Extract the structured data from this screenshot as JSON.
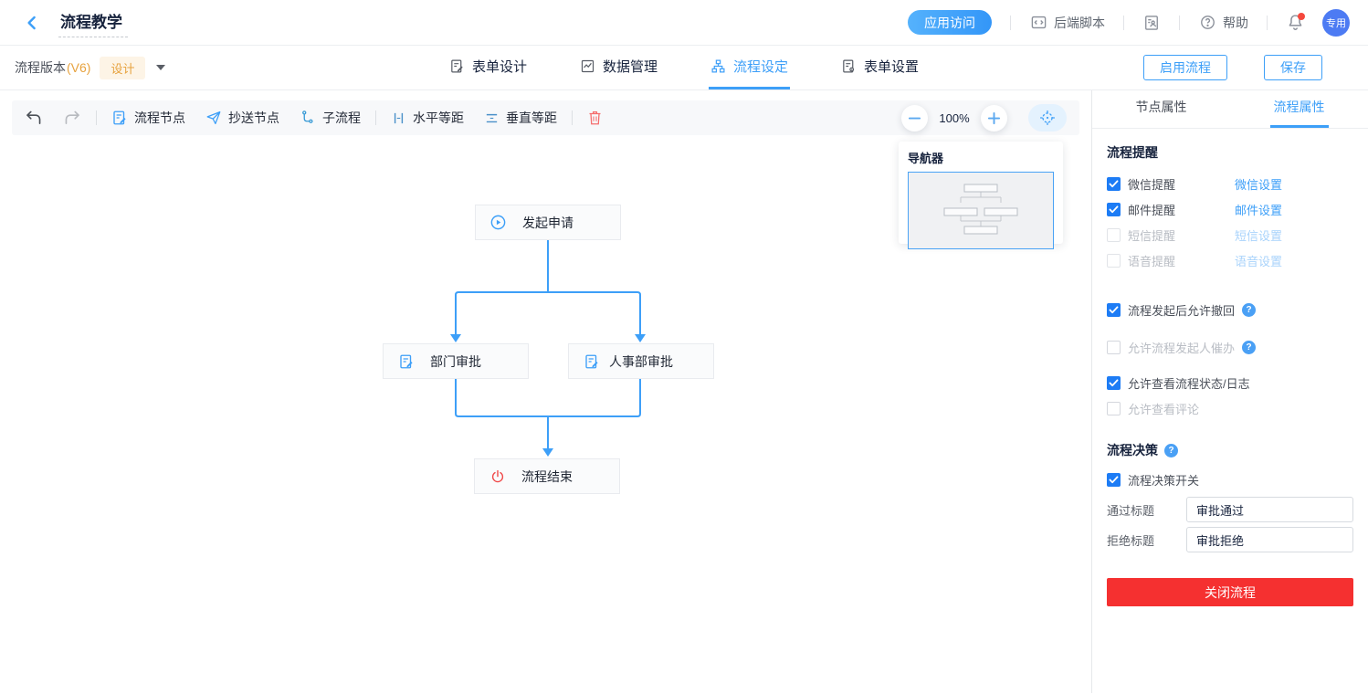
{
  "header": {
    "title": "流程教学",
    "app_access_label": "应用访问",
    "backend_script_label": "后端脚本",
    "help_label": "帮助",
    "avatar_label": "专用"
  },
  "subheader": {
    "version_label": "流程版本",
    "version_number": "(V6)",
    "design_badge": "设计",
    "tabs": [
      {
        "label": "表单设计",
        "active": false
      },
      {
        "label": "数据管理",
        "active": false
      },
      {
        "label": "流程设定",
        "active": true
      },
      {
        "label": "表单设置",
        "active": false
      }
    ],
    "enable_flow_label": "启用流程",
    "save_label": "保存"
  },
  "toolbar": {
    "flow_node_label": "流程节点",
    "cc_node_label": "抄送节点",
    "subflow_label": "子流程",
    "h_space_label": "水平等距",
    "v_space_label": "垂直等距",
    "zoom_level": "100%"
  },
  "navigator": {
    "title": "导航器"
  },
  "canvas": {
    "nodes": [
      {
        "id": "start",
        "label": "发起申请",
        "icon": "play-circle-icon"
      },
      {
        "id": "dept",
        "label": "部门审批",
        "icon": "edit-doc-icon"
      },
      {
        "id": "hr",
        "label": "人事部审批",
        "icon": "edit-doc-icon"
      },
      {
        "id": "end",
        "label": "流程结束",
        "icon": "power-icon"
      }
    ]
  },
  "sidebar": {
    "tabs": [
      {
        "label": "节点属性",
        "active": false
      },
      {
        "label": "流程属性",
        "active": true
      }
    ],
    "reminder": {
      "title": "流程提醒",
      "rows": [
        {
          "label": "微信提醒",
          "checked": true,
          "disabled": false,
          "link": "微信设置"
        },
        {
          "label": "邮件提醒",
          "checked": true,
          "disabled": false,
          "link": "邮件设置"
        },
        {
          "label": "短信提醒",
          "checked": false,
          "disabled": true,
          "link": "短信设置"
        },
        {
          "label": "语音提醒",
          "checked": false,
          "disabled": true,
          "link": "语音设置"
        }
      ]
    },
    "options": [
      {
        "label": "流程发起后允许撤回",
        "checked": true,
        "help": true
      },
      {
        "label": "允许流程发起人催办",
        "checked": false,
        "help": true
      },
      {
        "label": "允许查看流程状态/日志",
        "checked": true,
        "help": false
      },
      {
        "label": "允许查看评论",
        "checked": false,
        "help": false
      }
    ],
    "decision": {
      "title": "流程决策",
      "switch_label": "流程决策开关",
      "switch_checked": true,
      "pass_label": "通过标题",
      "pass_value": "审批通过",
      "reject_label": "拒绝标题",
      "reject_value": "审批拒绝"
    },
    "close_flow_label": "关闭流程"
  },
  "icons": {
    "help_glyph": "?"
  },
  "colors": {
    "accent_blue": "#3d9ff8",
    "checkbox_blue": "#1d7cf5",
    "danger_red": "#f53030",
    "trash_red": "#f56c6c",
    "warning_orange": "#e7a23e",
    "avatar_blue": "#4d7bf3",
    "connector_blue": "#3d9ff8"
  }
}
